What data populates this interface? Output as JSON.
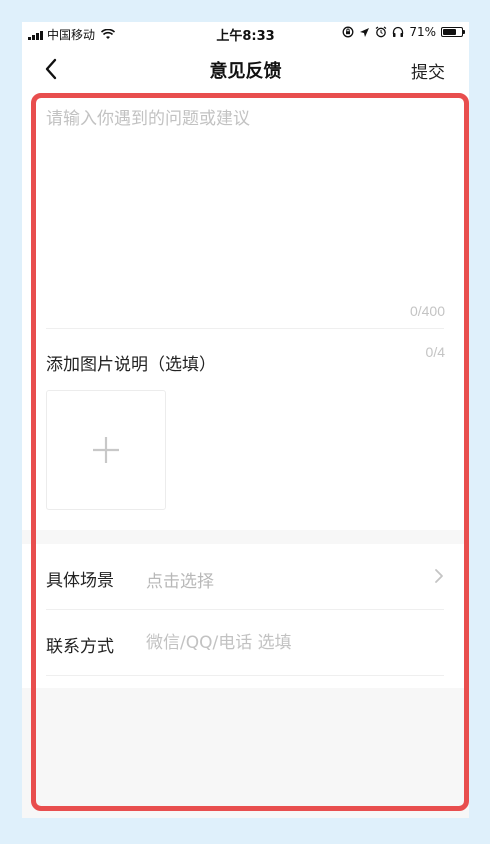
{
  "status_bar": {
    "carrier": "中国移动",
    "time": "上午8:33",
    "battery_percent": "71%",
    "battery_level": 0.71,
    "icons": [
      "signal-icon",
      "wifi-icon",
      "lock-rotation-icon",
      "location-icon",
      "alarm-icon",
      "headphones-icon",
      "battery-icon"
    ]
  },
  "nav": {
    "title": "意见反馈",
    "submit_label": "提交",
    "back_icon": "chevron-left-icon"
  },
  "feedback": {
    "placeholder": "请输入你遇到的问题或建议",
    "char_count": "0/400"
  },
  "image_section": {
    "label": "添加图片说明（选填）",
    "count": "0/4",
    "add_icon": "plus-icon"
  },
  "options": {
    "scene": {
      "label": "具体场景",
      "value": "点击选择",
      "icon": "chevron-right-icon"
    },
    "contact": {
      "label": "联系方式",
      "placeholder": "微信/QQ/电话 选填"
    }
  },
  "colors": {
    "background": "#dff0fb",
    "highlight": "#e84e4e",
    "placeholder": "#c2c2c2"
  }
}
